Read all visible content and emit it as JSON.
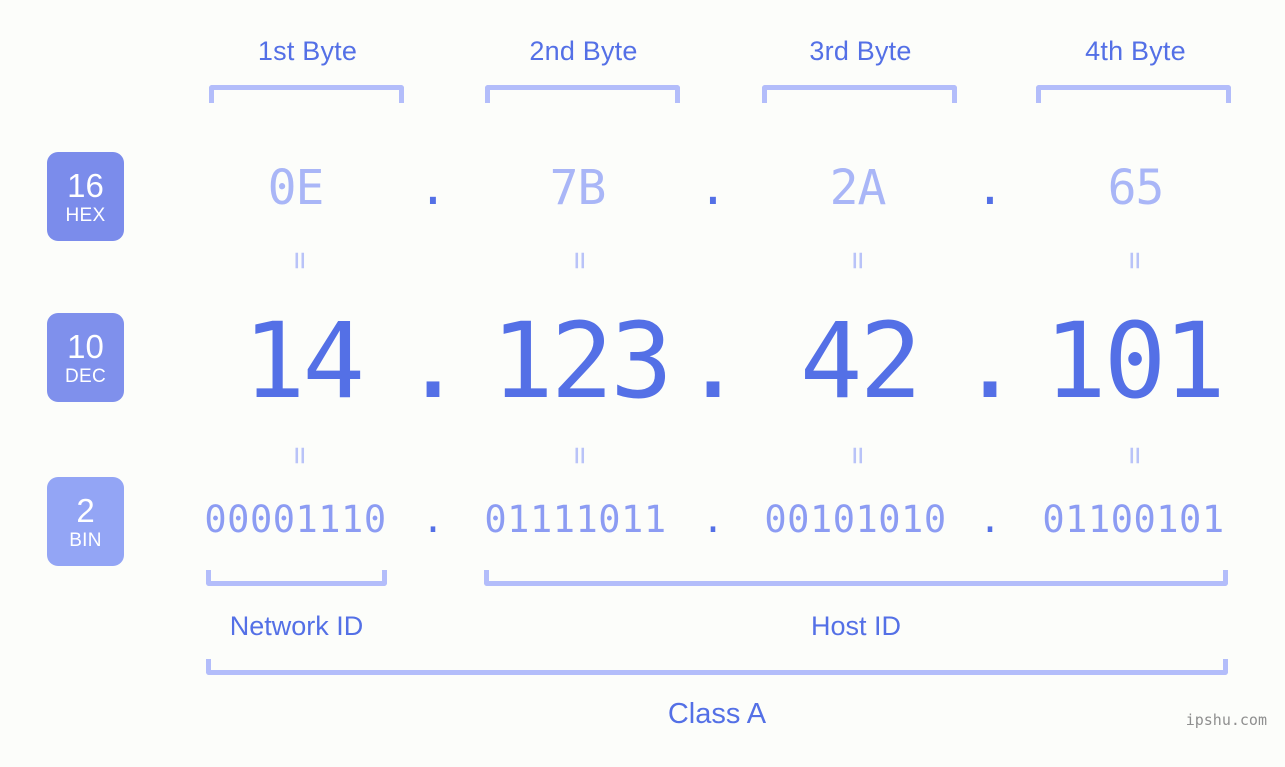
{
  "background_color": "#fcfdfa",
  "accent_color": "#5470e6",
  "accent_light_color": "#a9b6f7",
  "bracket_color": "#b3bdfa",
  "headers": [
    {
      "label": "1st Byte"
    },
    {
      "label": "2nd Byte"
    },
    {
      "label": "3rd Byte"
    },
    {
      "label": "4th Byte"
    }
  ],
  "radix_badges": [
    {
      "number": "16",
      "abbr": "HEX",
      "color": "#7b8ceb"
    },
    {
      "number": "10",
      "abbr": "DEC",
      "color": "#7f90ec"
    },
    {
      "number": "2",
      "abbr": "BIN",
      "color": "#93a5f5"
    }
  ],
  "rows": {
    "hex": {
      "values": [
        "0E",
        "7B",
        "2A",
        "65"
      ],
      "separator": "."
    },
    "dec": {
      "values": [
        "14",
        "123",
        "42",
        "101"
      ],
      "separator": "."
    },
    "bin": {
      "values": [
        "00001110",
        "01111011",
        "00101010",
        "01100101"
      ],
      "separator": "."
    }
  },
  "equals_symbol": "=",
  "segments": {
    "network_id": {
      "label": "Network ID"
    },
    "host_id": {
      "label": "Host ID"
    },
    "class": {
      "label": "Class A"
    }
  },
  "watermark": {
    "text": "ipshu.com"
  }
}
